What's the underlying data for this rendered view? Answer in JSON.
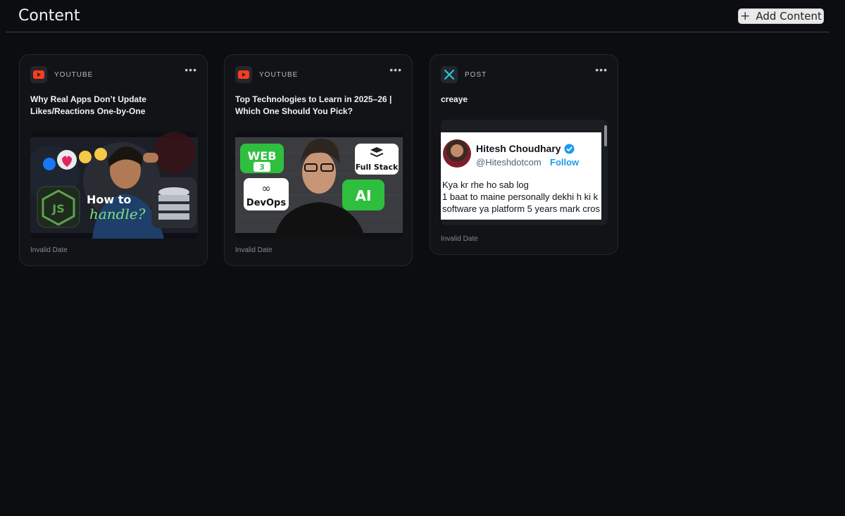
{
  "header": {
    "title": "Content",
    "add_button_label": "Add Content"
  },
  "cards": [
    {
      "source": "YOUTUBE",
      "source_icon": "youtube-icon",
      "title": "Why Real Apps Don’t Update Likes/Reactions One-by-One",
      "thumbnail": {
        "line1": "How to",
        "line2": "handle?",
        "badge": "JS"
      },
      "date": "Invalid Date"
    },
    {
      "source": "YOUTUBE",
      "source_icon": "youtube-icon",
      "title": "Top Technologies to Learn in 2025–26 | Which One Should You Pick?",
      "thumbnail": {
        "web": "WEB",
        "web_num": "3",
        "devops": "DevOps",
        "fullstack": "Full Stack",
        "ai": "AI"
      },
      "date": "Invalid Date"
    },
    {
      "source": "POST",
      "source_icon": "x-icon",
      "title": "creaye",
      "tweet": {
        "name": "Hitesh Choudhary",
        "handle": "@Hiteshdotcom",
        "follow": "Follow",
        "line1": "Kya kr rhe ho sab log",
        "line2": "1 baat to maine personally dekhi h ki k",
        "line3": "software ya platform 5 years mark cros"
      },
      "date": "Invalid Date"
    }
  ],
  "colors": {
    "background": "#0b0d11",
    "card": "#111317",
    "youtube_red": "#ff3d1a",
    "x_teal": "#2ec4d6",
    "twitter_blue": "#1d9bf0"
  }
}
